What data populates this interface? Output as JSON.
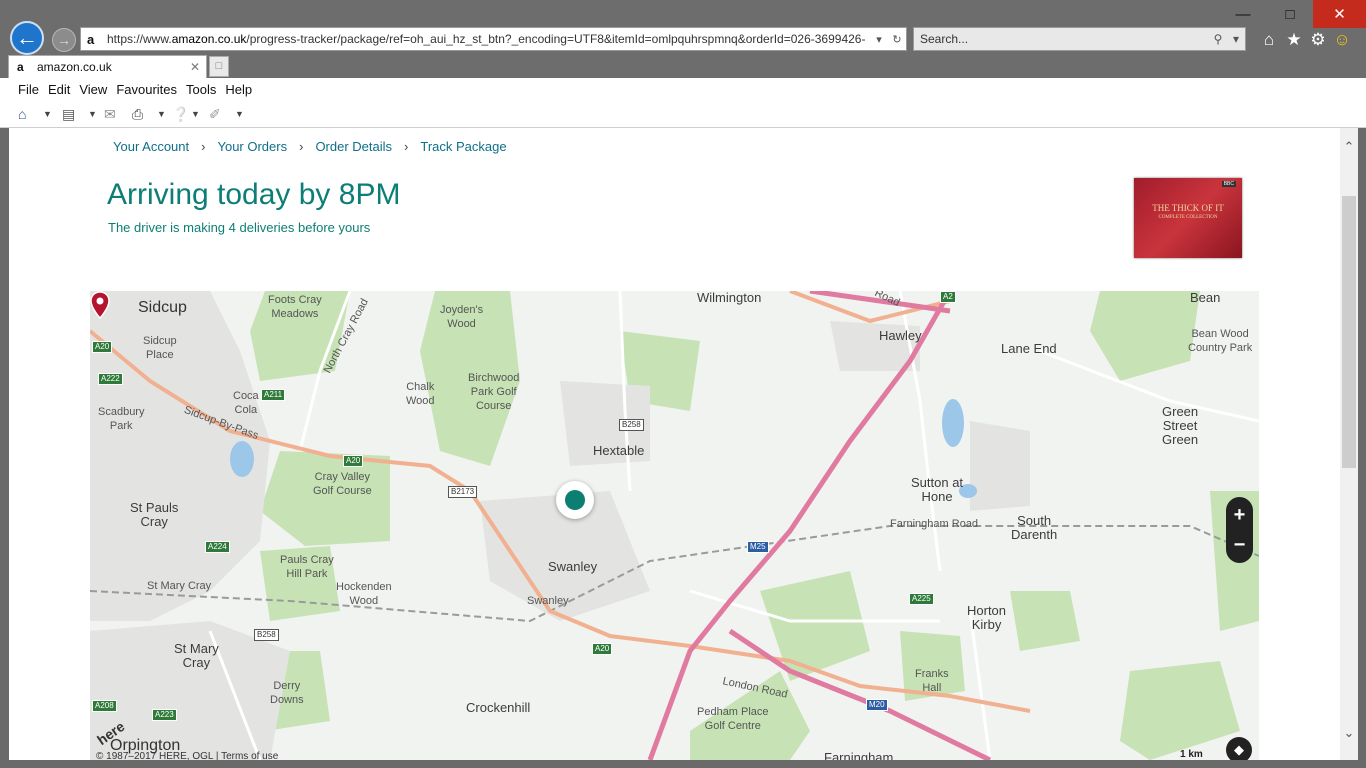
{
  "browser": {
    "url_prefix": "https://www.",
    "url_domain": "amazon.co.uk",
    "url_rest": "/progress-tracker/package/ref=oh_aui_hz_st_btn?_encoding=UTF8&itemId=omlpquhrspmnq&orderId=026-3699426-",
    "search_placeholder": "Search...",
    "tab_title": "amazon.co.uk",
    "menu": [
      "File",
      "Edit",
      "View",
      "Favourites",
      "Tools",
      "Help"
    ]
  },
  "breadcrumbs": [
    "Your Account",
    "Your Orders",
    "Order Details",
    "Track Package"
  ],
  "delivery": {
    "headline": "Arriving today by 8PM",
    "subline": "The driver is making 4 deliveries before yours"
  },
  "product": {
    "title": "THE THICK OF IT",
    "subtitle": "COMPLETE COLLECTION",
    "logo": "BBC"
  },
  "map": {
    "places": {
      "sidcup": "Sidcup",
      "foots_cray": "Foots Cray\nMeadows",
      "north_cray_road": "North Cray Road",
      "joydens_wood": "Joyden's\nWood",
      "wilmington": "Wilmington",
      "hawley": "Hawley",
      "lane_end": "Lane End",
      "bean": "Bean",
      "bean_wood": "Bean Wood\nCountry Park",
      "sidcup_place": "Sidcup\nPlace",
      "coca_cola": "Coca\nCola",
      "chalk_wood": "Chalk\nWood",
      "birchwood": "Birchwood\nPark Golf\nCourse",
      "scadbury": "Scadbury\nPark",
      "sidcup_by_pass": "Sidcup-By-Pass",
      "hextable": "Hextable",
      "green_street_green": "Green\nStreet\nGreen",
      "cray_valley": "Cray Valley\nGolf Course",
      "sutton_at_hone": "Sutton at\nHone",
      "st_pauls_cray": "St Pauls\nCray",
      "farningham_road": "Farningham Road",
      "south_darenth": "South\nDarenth",
      "swanley": "Swanley",
      "pauls_cray_hill": "Pauls Cray\nHill Park",
      "st_mary_cray_station": "St Mary Cray",
      "hockenden_wood": "Hockenden\nWood",
      "swanley_station": "Swanley",
      "horton_kirby": "Horton\nKirby",
      "st_mary_cray": "St Mary\nCray",
      "derry_downs": "Derry\nDowns",
      "london_road": "London Road",
      "franks_hall": "Franks\nHall",
      "crockenhill": "Crockenhill",
      "pedham_place": "Pedham Place\nGolf Centre",
      "orpington": "Orpington",
      "farningham": "Farningham"
    },
    "roads": {
      "a20_1": "A20",
      "a222": "A222",
      "a211": "A211",
      "a20_2": "A20",
      "b2173": "B2173",
      "b258_1": "B258",
      "a224": "A224",
      "m25": "M25",
      "a225": "A225",
      "b258_2": "B258",
      "a20_3": "A20",
      "a208": "A208",
      "a223": "A223",
      "m20": "M20",
      "a2": "A2",
      "road_top": "Road"
    },
    "zoom_in": "+",
    "zoom_out": "−",
    "scale": "1 km",
    "copyright": "© 1987–2017 HERE, OGL |",
    "terms": "Terms of use",
    "logo": "here"
  },
  "icons": {
    "back": "←",
    "forward": "→",
    "home": "⌂",
    "star": "★",
    "gear": "⚙",
    "smiley": "☺"
  }
}
